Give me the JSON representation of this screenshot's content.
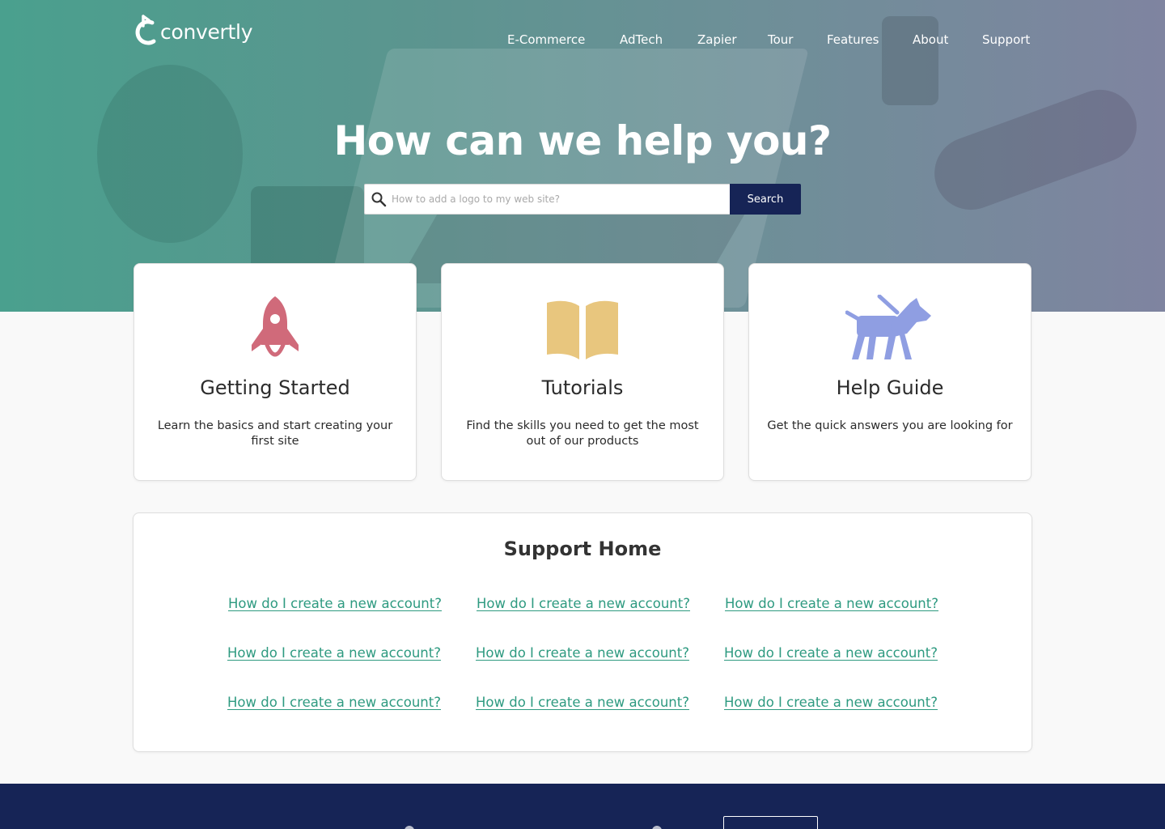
{
  "brand": {
    "name": "convertly",
    "icon": "convertly-logo-icon"
  },
  "nav": {
    "items": [
      {
        "label": "E-Commerce"
      },
      {
        "label": "AdTech"
      },
      {
        "label": "Zapier"
      },
      {
        "label": "Tour"
      },
      {
        "label": "Features"
      },
      {
        "label": "About"
      },
      {
        "label": "Support"
      }
    ]
  },
  "hero": {
    "title": "How can we help you?",
    "search": {
      "placeholder": "How to add a logo to my web site?",
      "value": "",
      "button_label": "Search",
      "icon": "search-icon"
    }
  },
  "cards": [
    {
      "title": "Getting Started",
      "description": "Learn the basics and start creating your first site",
      "icon": "rocket-icon",
      "icon_color": "#d06a7a"
    },
    {
      "title": "Tutorials",
      "description": "Find the skills you need to get the most out of our products",
      "icon": "open-book-icon",
      "icon_color": "#e8c67e"
    },
    {
      "title": "Help Guide",
      "description": "Get the quick answers you are looking for",
      "icon": "guide-dog-icon",
      "icon_color": "#8f9ee2"
    }
  ],
  "support": {
    "title": "Support Home",
    "links": [
      [
        "How do I create a new account?",
        "How do I create a new account?",
        "How do I create a new account?"
      ],
      [
        "How do I create a new account?",
        "How do I create a new account?",
        "How do I create a new account?"
      ],
      [
        "How do I create a new account?",
        "How do I create a new account?",
        "How do I create a new account?"
      ]
    ]
  },
  "colors": {
    "accent": "#2e9a80",
    "navy": "#162456",
    "hero_teal": "#4aa08e",
    "hero_violet": "#7f84a0"
  }
}
